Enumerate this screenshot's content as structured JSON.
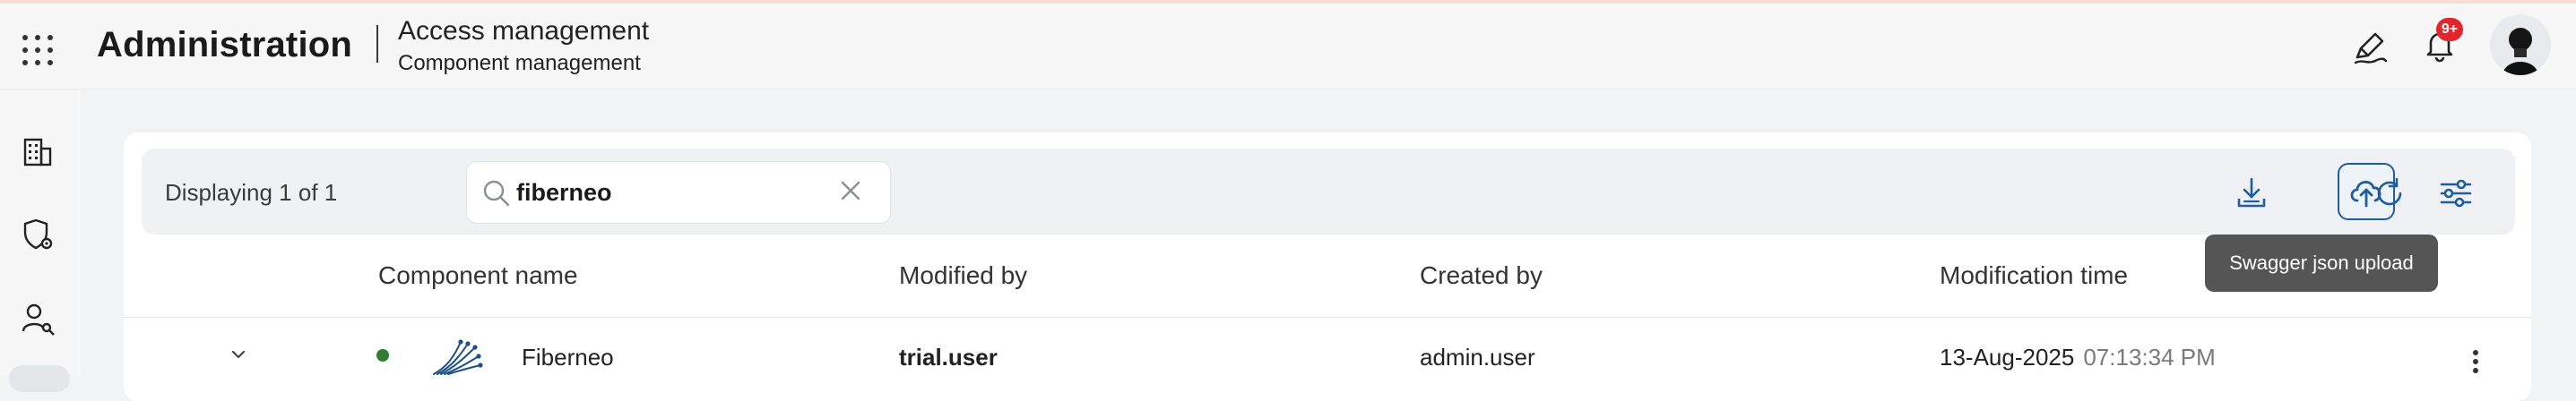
{
  "header": {
    "app_title": "Administration",
    "breadcrumb_main": "Access management",
    "breadcrumb_sub": "Component management",
    "notifications_badge": "9+"
  },
  "toolbar": {
    "displaying": "Displaying 1 of 1",
    "search_value": "fiberneo",
    "upload_tooltip": "Swagger json upload"
  },
  "table": {
    "columns": [
      "Component name",
      "Modified by",
      "Created by",
      "Modification time"
    ],
    "rows": [
      {
        "component_name": "Fiberneo",
        "modified_by": "trial.user",
        "created_by": "admin.user",
        "modification_date": "13-Aug-2025",
        "modification_time": "07:13:34 PM",
        "status_color": "#2e7d32"
      }
    ]
  },
  "icons": {
    "apps": "apps-grid-icon",
    "edit": "pen-icon",
    "notifications": "bell-icon",
    "sidebar_1": "building-icon",
    "sidebar_2": "shield-gear-icon",
    "sidebar_3": "user-key-icon",
    "download": "download-icon",
    "upload": "cloud-upload-icon",
    "refresh": "refresh-icon",
    "settings": "sliders-icon"
  },
  "colors": {
    "accent": "#1f5d9e",
    "badge": "#e0262b"
  }
}
